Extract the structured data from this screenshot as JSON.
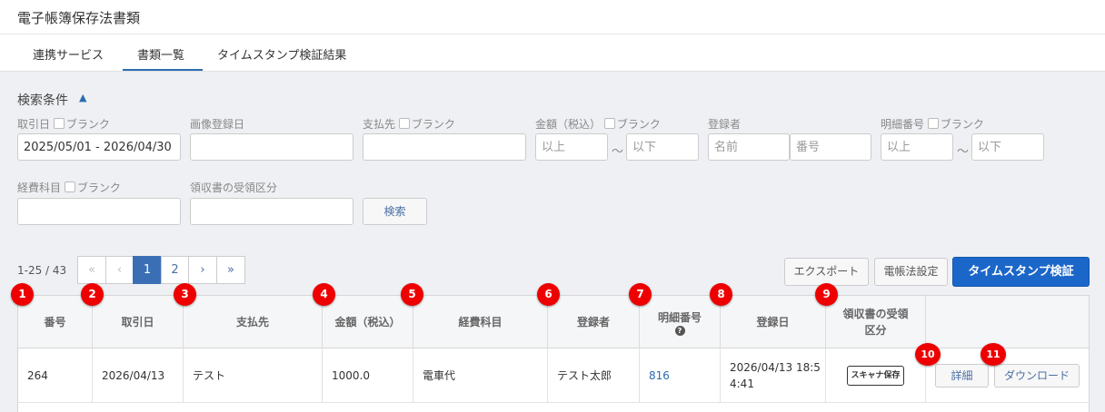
{
  "app": {
    "title": "電子帳簿保存法書類"
  },
  "tabs": [
    {
      "label": "連携サービス"
    },
    {
      "label": "書類一覧"
    },
    {
      "label": "タイムスタンプ検証結果"
    }
  ],
  "search": {
    "title": "検索条件",
    "blank_label": "ブランク",
    "fields": {
      "transaction_date": {
        "label": "取引日",
        "value": "2025/05/01 - 2026/04/30"
      },
      "image_registered_date": {
        "label": "画像登録日"
      },
      "payee": {
        "label": "支払先"
      },
      "amount": {
        "label": "金額（税込）",
        "min_placeholder": "以上",
        "max_placeholder": "以下"
      },
      "registrant": {
        "label": "登録者",
        "name_placeholder": "名前",
        "number_placeholder": "番号"
      },
      "detail_number": {
        "label": "明細番号",
        "min_placeholder": "以上",
        "max_placeholder": "以下"
      },
      "expense_account": {
        "label": "経費科目"
      },
      "receipt_category": {
        "label": "領収書の受領区分"
      }
    },
    "tilde": "～",
    "search_button": "検索"
  },
  "results": {
    "count": "1-25 / 43",
    "pages": [
      "1",
      "2"
    ],
    "current_page": "1",
    "export_button": "エクスポート",
    "settings_button": "電帳法設定",
    "verify_button": "タイムスタンプ検証"
  },
  "table": {
    "headers": [
      "番号",
      "取引日",
      "支払先",
      "金額（税込）",
      "経費科目",
      "登録者",
      "明細番号",
      "登録日",
      "領収書の受領",
      "区分"
    ],
    "rows": [
      {
        "number": "264",
        "transaction_date": "2026/04/13",
        "payee": "テスト",
        "amount": "1000.0",
        "expense_account": "電車代",
        "registrant": "テスト太郎",
        "detail_number": "816",
        "registered_line1": "2026/04/13 18:5",
        "registered_line2": "4:41",
        "receipt_badge": "スキャナ保存",
        "detail_button": "詳細",
        "download_button": "ダウンロード"
      }
    ]
  },
  "markers": [
    "1",
    "2",
    "3",
    "4",
    "5",
    "6",
    "7",
    "8",
    "9",
    "10",
    "11"
  ],
  "colors": {
    "primary": "#1b66c9",
    "marker": "#ee0000",
    "active_page": "#3b6fb5"
  }
}
